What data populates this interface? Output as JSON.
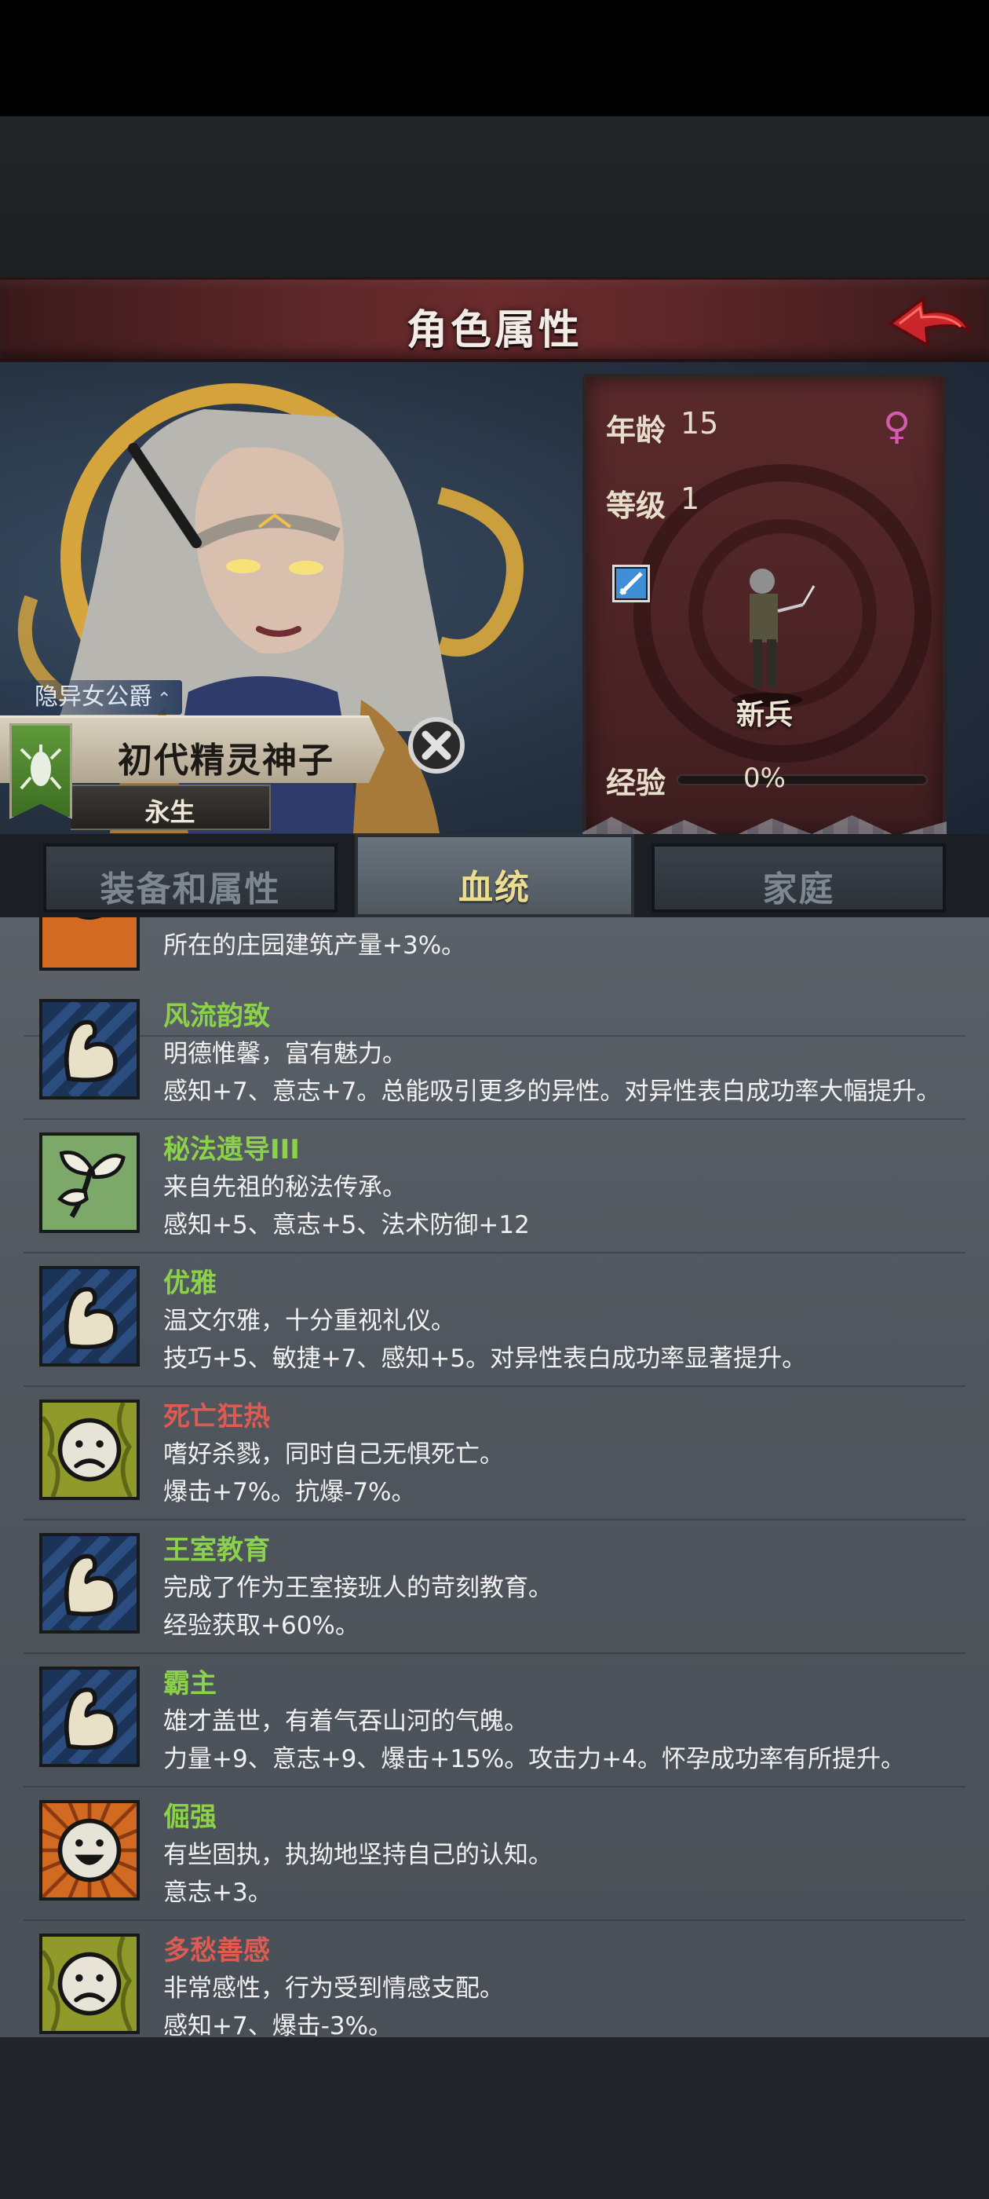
{
  "header": {
    "title": "角色属性"
  },
  "character": {
    "noble_title": "隐异女公爵",
    "name": "初代精灵神子",
    "race": "永生"
  },
  "stats": {
    "age_label": "年龄",
    "age_value": "15",
    "level_label": "等级",
    "level_value": "1",
    "gender": "female",
    "unit_name": "新兵",
    "exp_label": "经验",
    "exp_text": "0%",
    "exp_fraction": 0
  },
  "tabs": [
    {
      "label": "装备和属性",
      "active": false
    },
    {
      "label": "血统",
      "active": true
    },
    {
      "label": "家庭",
      "active": false
    }
  ],
  "traits": [
    {
      "name": "",
      "desc": "",
      "effect": "所在的庄园建筑产量+3%。",
      "name_color": "#8bd24a",
      "icon": "sun-icon"
    },
    {
      "name": "风流韵致",
      "desc": "明德惟馨，富有魅力。",
      "effect": "感知+7、意志+7。总能吸引更多的异性。对异性表白成功率大幅提升。",
      "name_color": "#8bd24a",
      "icon": "flexed-arm-icon"
    },
    {
      "name": "秘法遗导III",
      "desc": "来自先祖的秘法传承。",
      "effect": "感知+5、意志+5、法术防御+12",
      "name_color": "#8bd24a",
      "icon": "sprout-icon"
    },
    {
      "name": "优雅",
      "desc": "温文尔雅，十分重视礼仪。",
      "effect": "技巧+5、敏捷+7、感知+5。对异性表白成功率显著提升。",
      "name_color": "#8bd24a",
      "icon": "flexed-arm-icon"
    },
    {
      "name": "死亡狂热",
      "desc": "嗜好杀戮，同时自己无惧死亡。",
      "effect": "爆击+7%。抗爆-7%。",
      "name_color": "#e05a52",
      "icon": "sad-face-icon"
    },
    {
      "name": "王室教育",
      "desc": "完成了作为王室接班人的苛刻教育。",
      "effect": "经验获取+60%。",
      "name_color": "#8bd24a",
      "icon": "flexed-arm-icon"
    },
    {
      "name": "霸主",
      "desc": "雄才盖世，有着气吞山河的气魄。",
      "effect": "力量+9、意志+9、爆击+15%。攻击力+4。怀孕成功率有所提升。",
      "name_color": "#8bd24a",
      "icon": "flexed-arm-icon"
    },
    {
      "name": "倔强",
      "desc": "有些固执，执拗地坚持自己的认知。",
      "effect": "意志+3。",
      "name_color": "#8bd24a",
      "icon": "happy-face-icon"
    },
    {
      "name": "多愁善感",
      "desc": "非常感性，行为受到情感支配。",
      "effect": "感知+7、爆击-3%。",
      "name_color": "#e05a52",
      "icon": "sad-face-icon"
    }
  ]
}
